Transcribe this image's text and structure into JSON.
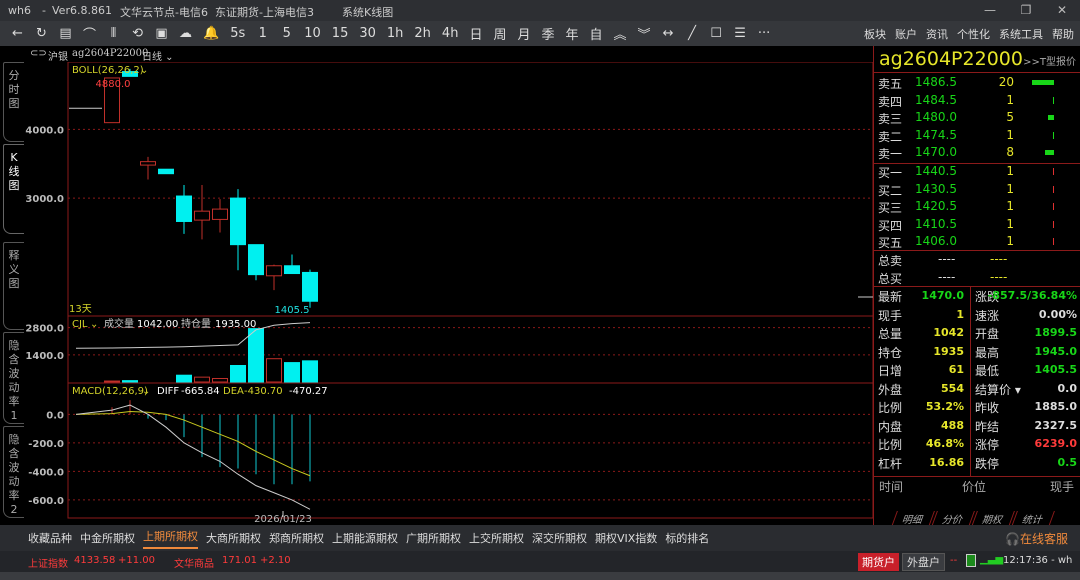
{
  "titlebar": {
    "app": "wh6",
    "version": "Ver6.8.861",
    "node": "文华云节点-电信6",
    "broker": "东证期货-上海电信3",
    "view": "系统K线图",
    "minimize": "—",
    "maximize": "❐",
    "close": "✕"
  },
  "toolbar": {
    "items": [
      "←",
      "↻",
      "▤",
      "⌒",
      "⫴",
      "⟲",
      "▣",
      "☁",
      "🔔",
      "5s",
      "1",
      "5",
      "10",
      "15",
      "30",
      "1h",
      "2h",
      "4h",
      "日",
      "周",
      "月",
      "季",
      "年",
      "自",
      "︽",
      "︾",
      "↔",
      "╱",
      "☐",
      "☰",
      "···"
    ],
    "menu": [
      "板块",
      "账户",
      "资讯",
      "个性化",
      "系统工具",
      "帮助"
    ]
  },
  "symbol_bar": {
    "link_icon": "⊂⊃",
    "exchange": "沪银",
    "code": "ag2604P22000",
    "period": "日线"
  },
  "left_tabs": [
    [
      "分",
      "时",
      "图"
    ],
    [
      "K",
      "线",
      "图"
    ],
    [
      "释",
      "义",
      "图"
    ],
    [
      "隐",
      "含",
      "波",
      "动",
      "率",
      "1"
    ],
    [
      "隐",
      "含",
      "波",
      "动",
      "率",
      "2"
    ]
  ],
  "chart_data": [
    {
      "type": "candlestick",
      "title": "BOLL(26,26,2)",
      "ylim": [
        1300,
        4950
      ],
      "yticks": [
        "4000.0",
        "3000.0"
      ],
      "ytick_values": [
        4000,
        3000
      ],
      "max_label": "4880.0",
      "min_label": "1405.5",
      "days_label": "13天",
      "candles": [
        {
          "o": 4306,
          "h": 4306,
          "l": 4306,
          "c": 4306
        },
        {
          "o": 4097,
          "h": 4747,
          "l": 4097,
          "c": 4747
        },
        {
          "o": 4840,
          "h": 4880,
          "l": 4770,
          "c": 4770
        },
        {
          "o": 3480,
          "h": 3600,
          "l": 3270,
          "c": 3530
        },
        {
          "o": 3420,
          "h": 3420,
          "l": 3355,
          "c": 3355
        },
        {
          "o": 3030,
          "h": 3190,
          "l": 2480,
          "c": 2660
        },
        {
          "o": 2680,
          "h": 3190,
          "l": 2400,
          "c": 2810
        },
        {
          "o": 2690,
          "h": 2985,
          "l": 2500,
          "c": 2840
        },
        {
          "o": 3000,
          "h": 3130,
          "l": 1950,
          "c": 2323
        },
        {
          "o": 2323,
          "h": 2323,
          "l": 1806,
          "c": 1887
        },
        {
          "o": 1870,
          "h": 2032,
          "l": 1661,
          "c": 2016
        },
        {
          "o": 2016,
          "h": 2180,
          "l": 1903,
          "c": 1903
        },
        {
          "o": 1919,
          "h": 1960,
          "l": 1405.5,
          "c": 1500
        }
      ]
    },
    {
      "type": "bar",
      "title": "CJL",
      "vol_label": "成交量",
      "vol_value": "1042.00",
      "oi_label": "持仓量",
      "oi_value": "1935.00",
      "ylim": [
        0,
        3400
      ],
      "yticks": [
        "2800.0",
        "1400.0"
      ],
      "ytick_values": [
        2800,
        1400
      ],
      "volume": [
        0,
        50,
        70,
        0,
        0,
        350,
        250,
        180,
        850,
        2750,
        1200,
        1000,
        1090
      ],
      "open_interest": [
        1000,
        1010,
        1020,
        1030,
        1040,
        1050,
        1070,
        1090,
        1110,
        1700,
        1850,
        1900,
        1935
      ]
    },
    {
      "type": "line",
      "title": "MACD(12,26,9)",
      "diff_label": "DIFF",
      "diff_value": "-665.84",
      "dea_label": "DEA",
      "dea_value": "-430.70",
      "macd_value": "-470.27",
      "ylim": [
        -720,
        220
      ],
      "yticks": [
        "0.0",
        "-200.0",
        "-400.0",
        "-600.0"
      ],
      "ytick_values": [
        0,
        -200,
        -400,
        -600
      ],
      "diff": [
        0,
        30,
        65,
        0,
        -90,
        -200,
        -270,
        -330,
        -420,
        -500,
        -550,
        -600,
        -665.84
      ],
      "dea": [
        0,
        5,
        20,
        15,
        0,
        -40,
        -90,
        -140,
        -190,
        -260,
        -320,
        -380,
        -430.7
      ],
      "macd": [
        0,
        50,
        100,
        -30,
        -40,
        -160,
        -300,
        -370,
        -380,
        -420,
        -490,
        -490,
        -470.27
      ],
      "date_label": "2026/01/23"
    }
  ],
  "quote": {
    "code": "ag2604P22000",
    "tprice": ">>T型报价",
    "asks": [
      [
        "卖五",
        "1486.5",
        "20",
        20
      ],
      [
        "卖四",
        "1484.5",
        "1",
        1
      ],
      [
        "卖三",
        "1480.0",
        "5",
        5
      ],
      [
        "卖二",
        "1474.5",
        "1",
        1
      ],
      [
        "卖一",
        "1470.0",
        "8",
        8
      ]
    ],
    "bids": [
      [
        "买一",
        "1440.5",
        "1",
        1
      ],
      [
        "买二",
        "1430.5",
        "1",
        1
      ],
      [
        "买三",
        "1420.5",
        "1",
        1
      ],
      [
        "买四",
        "1410.5",
        "1",
        1
      ],
      [
        "买五",
        "1406.0",
        "1",
        1
      ]
    ],
    "totals": [
      [
        "总卖",
        "----",
        "----"
      ],
      [
        "总买",
        "----",
        "----"
      ]
    ],
    "stats": [
      [
        "最新",
        "1470.0",
        "g",
        "涨跌",
        "-857.5/36.84%",
        "g"
      ],
      [
        "现手",
        "1",
        "y",
        "速涨",
        "0.00%",
        "w"
      ],
      [
        "总量",
        "1042",
        "y",
        "开盘",
        "1899.5",
        "g"
      ],
      [
        "持仓",
        "1935",
        "y",
        "最高",
        "1945.0",
        "g"
      ],
      [
        "日增",
        "61",
        "y",
        "最低",
        "1405.5",
        "g"
      ],
      [
        "外盘",
        "554",
        "y",
        "结算价 ▾",
        "0.0",
        "w"
      ],
      [
        "比例",
        "53.2%",
        "y",
        "昨收",
        "1885.0",
        "w"
      ],
      [
        "内盘",
        "488",
        "y",
        "昨结",
        "2327.5",
        "w"
      ],
      [
        "比例",
        "46.8%",
        "y",
        "涨停",
        "6239.0",
        "r"
      ],
      [
        "杠杆",
        "16.86",
        "y",
        "跌停",
        "0.5",
        "g"
      ]
    ],
    "ticks_header": [
      "时间",
      "价位",
      "现手"
    ],
    "tabs": [
      "明细",
      "分价",
      "期权",
      "统计"
    ]
  },
  "exchanges": [
    "收藏品种",
    "中金所期权",
    "上期所期权",
    "大商所期权",
    "郑商所期权",
    "上期能源期权",
    "广期所期权",
    "上交所期权",
    "深交所期权",
    "期权VIX指数",
    "标的排名"
  ],
  "exchange_active": 2,
  "service": "在线客服",
  "status": {
    "idx1_name": "上证指数",
    "idx1_val": "4133.58",
    "idx1_chg": "+11.00",
    "idx2_name": "文华商品",
    "idx2_val": "171.01",
    "idx2_chg": "+2.10",
    "futures_acct": "期货户",
    "foreign_acct": "外盘户",
    "sep": "--",
    "time": "12:17:36 - wh"
  },
  "colors": {
    "up": "#c0302a",
    "down": "#00f0f0",
    "grid": "#8b1a1a",
    "dea": "#c8c81e",
    "diff": "#cccccc"
  }
}
